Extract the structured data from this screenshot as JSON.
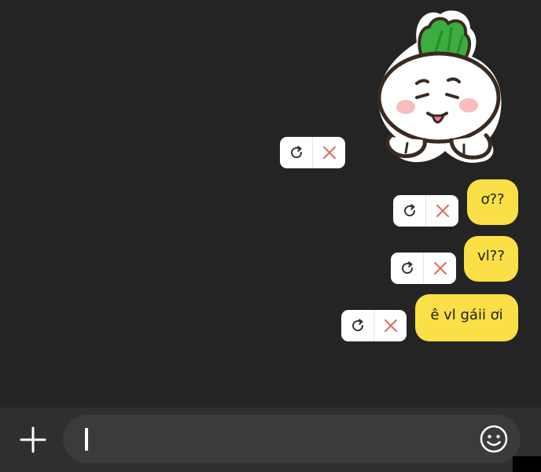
{
  "messages": [
    {
      "type": "sticker",
      "icon": "radish-sticker-icon",
      "status": "failed"
    },
    {
      "type": "text",
      "text": "ơ??",
      "status": "failed"
    },
    {
      "type": "text",
      "text": "vl??",
      "status": "failed"
    },
    {
      "type": "text",
      "text": "ê vl gáii ơi",
      "status": "failed"
    }
  ],
  "actions": {
    "retry_icon": "retry-icon",
    "delete_icon": "close-icon"
  },
  "composer": {
    "add_icon": "plus-icon",
    "input_value": "",
    "emoji_icon": "smiley-icon"
  },
  "colors": {
    "background": "#242424",
    "bubble": "#fae046",
    "bubble_text": "#1e1e1e",
    "action_bg": "#ffffff",
    "delete_x": "#e06b5f",
    "composer_bg": "#2f2f2f",
    "input_bg": "#3b3b3b",
    "sticker_green": "#3cae3f"
  }
}
